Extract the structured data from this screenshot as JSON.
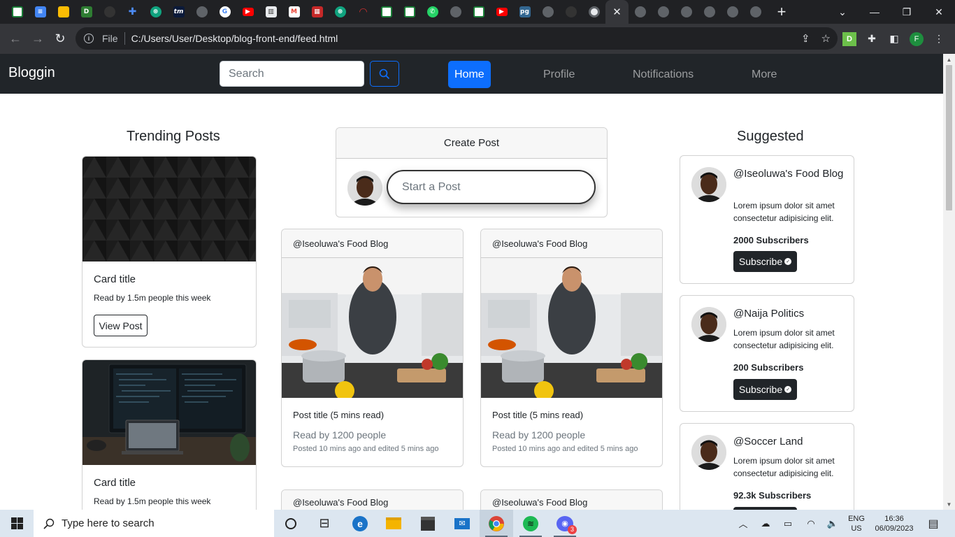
{
  "browser": {
    "tabs_count": 27,
    "url_scheme_label": "File",
    "url": "C:/Users/User/Desktop/blog-front-end/feed.html",
    "profile_initial": "F"
  },
  "app": {
    "brand": "Bloggin",
    "search": {
      "placeholder": "Search"
    },
    "nav": [
      {
        "label": "Home",
        "active": true
      },
      {
        "label": "Profile"
      },
      {
        "label": "Notifications"
      },
      {
        "label": "More"
      }
    ]
  },
  "trending": {
    "heading": "Trending Posts",
    "cards": [
      {
        "title": "Card title",
        "text": "Read by 1.5m people this week",
        "button": "View Post"
      },
      {
        "title": "Card title",
        "text": "Read by 1.5m people this week"
      }
    ]
  },
  "create_post": {
    "header": "Create Post",
    "placeholder": "Start a Post"
  },
  "posts": [
    {
      "author": "@Iseoluwa's Food Blog",
      "title": "Post title (5 mins read)",
      "readers": "Read by 1200 people",
      "meta": "Posted 10 mins ago and edited 5 mins ago"
    },
    {
      "author": "@Iseoluwa's Food Blog",
      "title": "Post title (5 mins read)",
      "readers": "Read by 1200 people",
      "meta": "Posted 10 mins ago and edited 5 mins ago"
    },
    {
      "author": "@Iseoluwa's Food Blog"
    },
    {
      "author": "@Iseoluwa's Food Blog"
    }
  ],
  "suggested": {
    "heading": "Suggested",
    "items": [
      {
        "name": "@Iseoluwa's Food Blog",
        "desc": "Lorem ipsum dolor sit amet consectetur adipisicing elit.",
        "subs": "2000 Subscribers",
        "button": "Subscribe"
      },
      {
        "name": "@Naija Politics",
        "desc": "Lorem ipsum dolor sit amet consectetur adipisicing elit.",
        "subs": "200 Subscribers",
        "button": "Subscribe"
      },
      {
        "name": "@Soccer Land",
        "desc": "Lorem ipsum dolor sit amet consectetur adipisicing elit.",
        "subs": "92.3k Subscribers"
      }
    ]
  },
  "taskbar": {
    "search_placeholder": "Type here to search",
    "lang_top": "ENG",
    "lang_bottom": "US",
    "time": "16:36",
    "date": "06/09/2023",
    "notification_badge": "3"
  },
  "colors": {
    "primary": "#0d6efd",
    "navbar": "#212529",
    "chrome_dark": "#202124"
  }
}
